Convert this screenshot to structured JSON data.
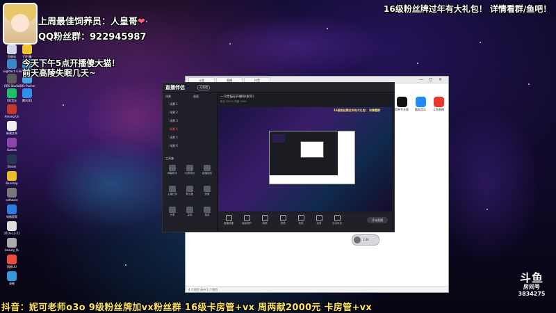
{
  "overlay": {
    "fan_line_prefix": "上周最佳饲养员：",
    "fan_line_name": "人皇哥",
    "fan_line_heart": "❤",
    "qq_line": "QQ粉丝群：922945987",
    "top_right": "16级粉丝牌过年有大礼包！ 详情看群/鱼吧！",
    "schedule_line1": "今天下午5点开播傻大猫！",
    "schedule_line2": "前天高陵失眠几天~",
    "bottom_ticker": "抖音：妮可老师o3o 9级粉丝牌加vx粉丝群 16级卡房管+vx 周两献2000元 卡房管+vx"
  },
  "watermark": {
    "brand": "斗鱼",
    "sub": "房间号",
    "room_number": "3834275"
  },
  "desktop_icons": [
    {
      "label": "回收站",
      "color": "#cfd8e6"
    },
    {
      "label": "YY开播",
      "color": "#f1c232"
    },
    {
      "label": "Loglitech G HUB",
      "color": "#3d86c6"
    },
    {
      "label": "GPRS ARTV",
      "color": "#3b9edc"
    },
    {
      "label": "OBS Studio",
      "color": "#5b5b5b"
    },
    {
      "label": "OBS-Pusher",
      "color": "#4aa4e8"
    },
    {
      "label": "QQ音乐",
      "color": "#1fbf6a"
    },
    {
      "label": "腾讯QQ",
      "color": "#2d8ff0"
    },
    {
      "label": "Among Us",
      "color": "#c0392b"
    },
    {
      "label": "新建文本",
      "color": "#eeeeee"
    },
    {
      "label": "Games",
      "color": "#8e44ad"
    },
    {
      "label": "Steam",
      "color": "#24364b"
    },
    {
      "label": "Bandizip",
      "color": "#e8bc2c"
    },
    {
      "label": "software",
      "color": "#777777"
    },
    {
      "label": "电脑管家",
      "color": "#2c7de0"
    },
    {
      "label": "2019-12-21",
      "color": "#dddddd"
    },
    {
      "label": "beauty_tk",
      "color": "#aaaaaa"
    },
    {
      "label": "网易UU",
      "color": "#e74c3c"
    },
    {
      "label": "录制",
      "color": "#3498db"
    }
  ],
  "outer_window": {
    "tabs": [
      "斗鱼",
      "直播",
      "抖音"
    ],
    "status_text": "4 个项目  选中 1 个项目",
    "window_controls": [
      "—",
      "□",
      "✕"
    ],
    "apps": [
      {
        "label": "剪映专业版",
        "color": "#111111"
      },
      {
        "label": "酷狗音乐",
        "color": "#1f8bf3"
      },
      {
        "label": "斗鱼直播",
        "color": "#e8392f"
      }
    ]
  },
  "inner_app": {
    "logo": "直播伴侣",
    "badge": "无频道",
    "tabs": [
      "场景",
      "画面"
    ],
    "scenes": [
      {
        "label": "场景 1",
        "active": false
      },
      {
        "label": "场景 2",
        "active": false
      },
      {
        "label": "场景 3",
        "active": false
      },
      {
        "label": "场景 4",
        "active": true
      },
      {
        "label": "场景 5",
        "active": false
      },
      {
        "label": "场景 6",
        "active": false
      }
    ],
    "tools_title": "工具箱",
    "tools": [
      "弹幕助手",
      "礼物特效",
      "直播回放",
      "主播任务",
      "粉丝团",
      "房管",
      "分享",
      "录制",
      "抽奖"
    ],
    "room_title": "一只傻猫在开播呀(妮可)",
    "room_meta": "粉丝 38234  热度 9999",
    "preview_caption": "16级粉丝牌过年有大礼包！ 详情看群",
    "bottom_buttons": [
      "直播设置",
      "画面调节",
      "美颜",
      "滤镜",
      "音效",
      "连麦",
      "互动玩法"
    ],
    "start_button": "开始直播",
    "pill_text": "1.4k"
  }
}
